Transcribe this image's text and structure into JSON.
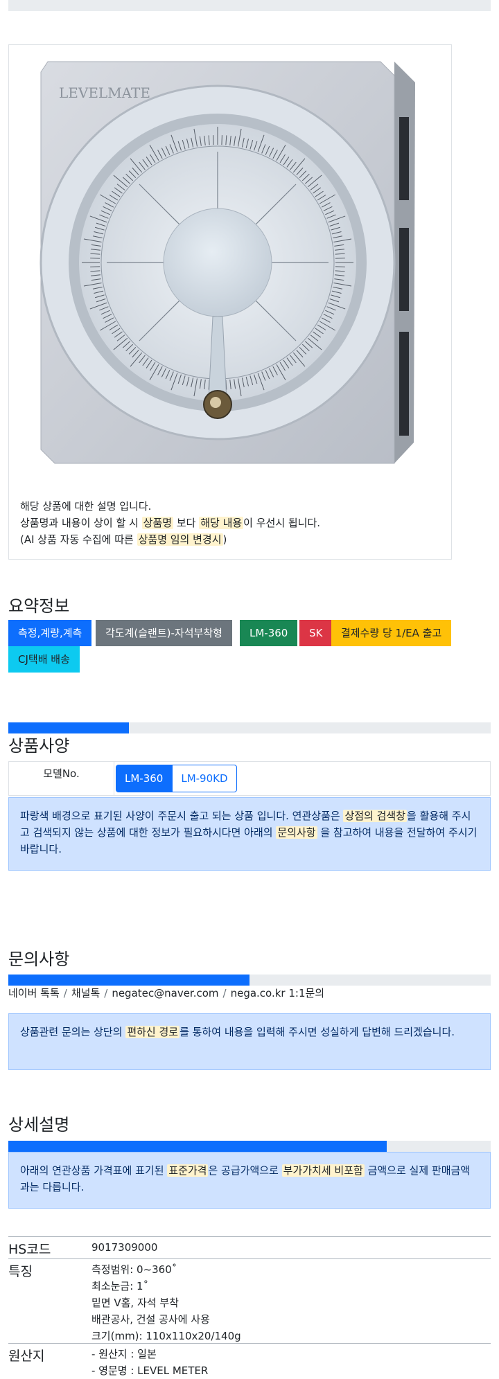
{
  "image_notes": {
    "line1": "해당 상품에 대한 설명 입니다.",
    "line2_a": "상품명과 내용이 상이 할 시 ",
    "line2_mark1": "상품명",
    "line2_b": " 보다 ",
    "line2_mark2": "해당 내용",
    "line2_c": "이 우선시 됩니다.",
    "line3_a": "(AI 상품 자동 수집에 따른 ",
    "line3_mark": "상품명 임의 변경시",
    "line3_b": ")"
  },
  "product_image": {
    "brand_text": "LEVELMATE",
    "icon": "inclinometer-image"
  },
  "summary": {
    "title": "요약정보",
    "badges": [
      {
        "label": "측정,계량,계측",
        "color": "#0d6efd",
        "text_color": "#ffffff"
      },
      {
        "label": "각도계(슬랜트)-자석부착형",
        "color": "#6c757d",
        "text_color": "#ffffff"
      },
      {
        "label": "LM-360",
        "color": "#198754",
        "text_color": "#ffffff"
      },
      {
        "label": "SK",
        "color": "#dc3545",
        "text_color": "#ffffff"
      },
      {
        "label": "결제수량 당 1/EA 출고",
        "color": "#ffc107",
        "text_color": "#212529"
      },
      {
        "label": "CJ택배 배송",
        "color": "#0dcaf0",
        "text_color": "#212529"
      }
    ]
  },
  "spec": {
    "title": "상품사양",
    "progress": 0.25,
    "model_label": "모델No.",
    "models": [
      "LM-360",
      "LM-90KD"
    ],
    "alert_a": "파랑색 배경으로 표기된 사양이 주문시 출고 되는 상품 입니다. 연관상품은 ",
    "alert_mark1": "상점의 검색창",
    "alert_b": "을 활용해 주시고 검색되지 않는 상품에 대한 정보가 필요하시다면 아래의 ",
    "alert_mark2": "문의사항",
    "alert_c": " 을 참고하여 내용을 전달하여 주시기 바랍니다."
  },
  "inquiry": {
    "title": "문의사항",
    "progress": 0.5,
    "contacts": [
      "네이버 톡톡",
      "채널톡",
      "negatec@naver.com",
      "nega.co.kr 1:1문의"
    ],
    "separator": "/",
    "alert_a": "상품관련 문의는 상단의 ",
    "alert_mark": "편하신 경로",
    "alert_b": "를 통하여 내용을 입력해 주시면 성실하게 답변해 드리겠습니다."
  },
  "detail": {
    "title": "상세설명",
    "progress": 0.785,
    "alert_a": "아래의 연관상품 가격표에 표기된 ",
    "alert_mark1": "표준가격",
    "alert_b": "은 공급가액으로 ",
    "alert_mark2": "부가가치세 비포함",
    "alert_c": " 금액으로 실제 판매금액과는 다릅니다."
  },
  "info": {
    "hs_label": "HS코드",
    "hs_value": "9017309000",
    "feature_label": "특징",
    "features": [
      "측정범위: 0~360˚",
      "최소눈금: 1˚",
      "밑면 V홈, 자석 부착",
      "배관공사, 건설 공사에 사용",
      "크기(mm): 110x110x20/140g"
    ],
    "origin_label": "원산지",
    "origin": [
      "- 원산지 : 일본",
      "- 영문명 : LEVEL METER"
    ]
  }
}
